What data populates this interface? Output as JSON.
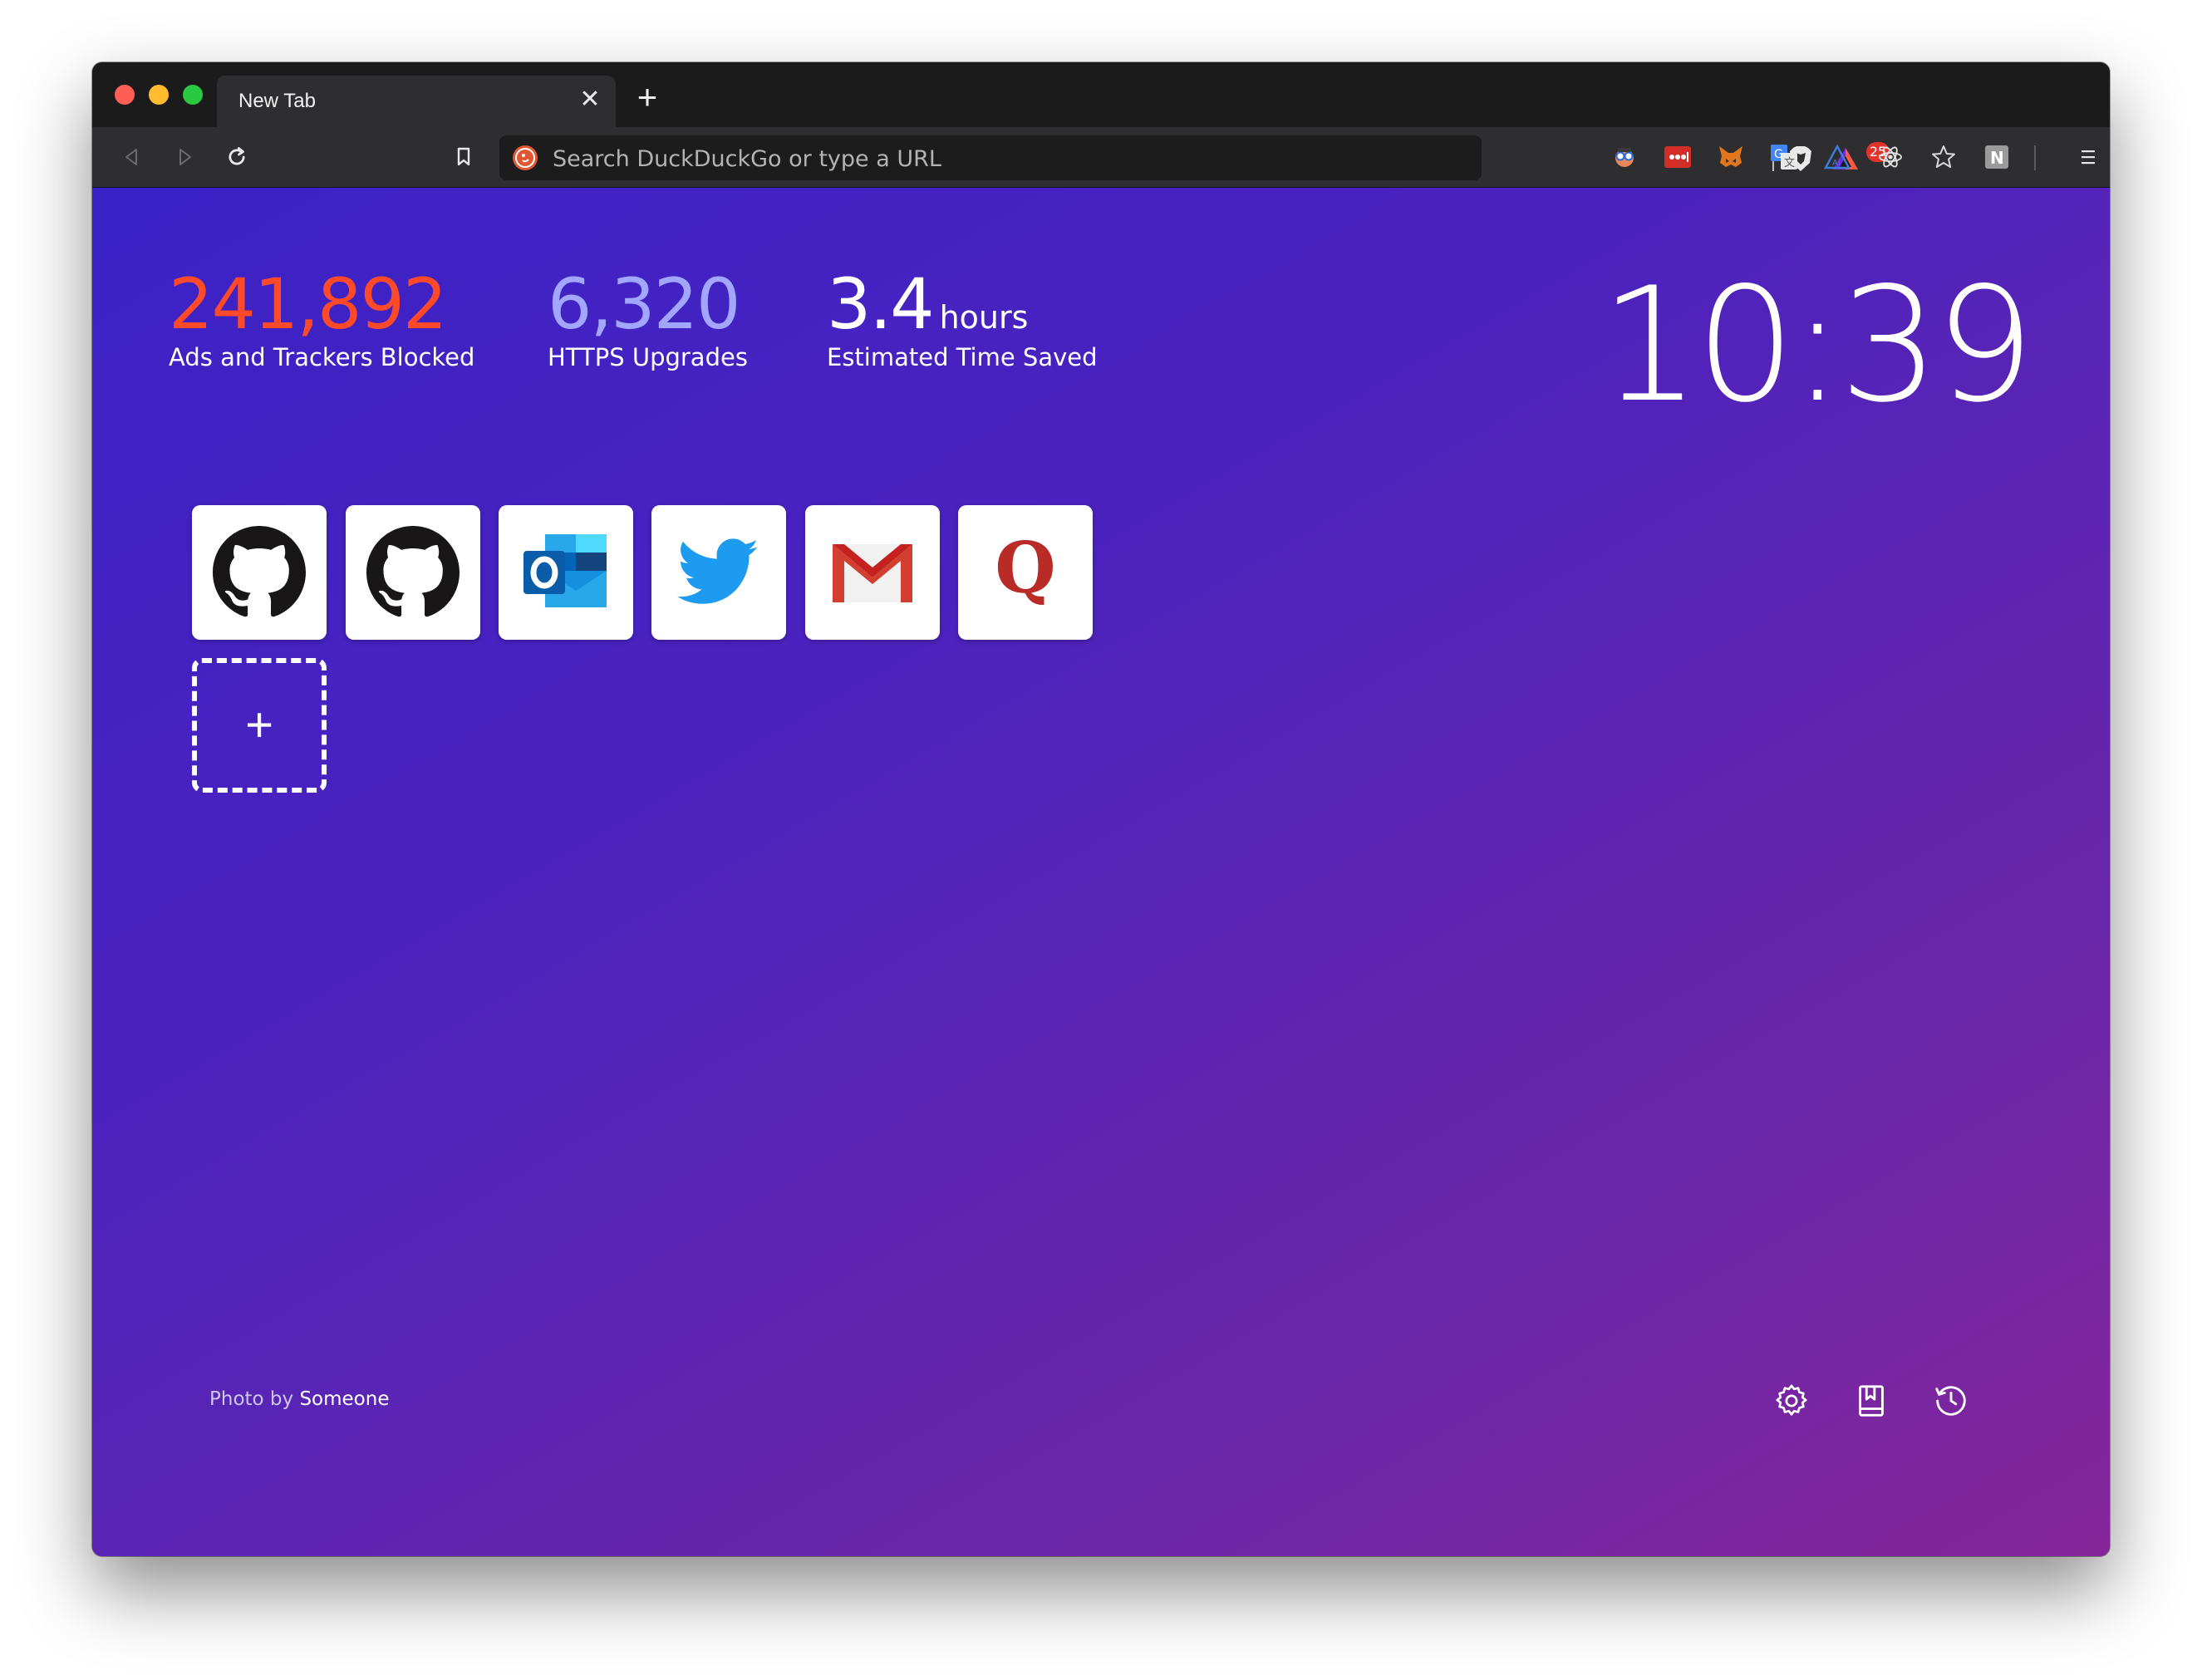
{
  "browser": {
    "tab": {
      "title": "New Tab",
      "close_symbol": "✕"
    },
    "new_tab_symbol": "+",
    "urlbar": {
      "placeholder": "Search DuckDuckGo or type a URL"
    },
    "rewards_badge": "25",
    "extension_icons": [
      "webcompat-icon",
      "lastpass-icon",
      "metamask-icon",
      "google-translate-icon",
      "react-devtools-icon",
      "atom-icon",
      "star-icon",
      "notion-icon"
    ]
  },
  "stats": {
    "trackers": {
      "value": "241,892",
      "label": "Ads and Trackers Blocked",
      "color": "#ff4a2a"
    },
    "https": {
      "value": "6,320",
      "label": "HTTPS Upgrades",
      "color": "#a3a6ff"
    },
    "time": {
      "value": "3.4",
      "unit": "hours",
      "label": "Estimated Time Saved",
      "color": "#ffffff"
    }
  },
  "clock": "10:39",
  "top_sites": [
    {
      "name": "github-icon"
    },
    {
      "name": "github-icon"
    },
    {
      "name": "outlook-icon"
    },
    {
      "name": "twitter-icon"
    },
    {
      "name": "gmail-icon"
    },
    {
      "name": "quora-icon"
    }
  ],
  "add_tile_symbol": "+",
  "photo_credit": {
    "prefix": "Photo by",
    "author": "Someone"
  },
  "footer_icons": [
    "settings-icon",
    "bookmarks-icon",
    "history-icon"
  ]
}
